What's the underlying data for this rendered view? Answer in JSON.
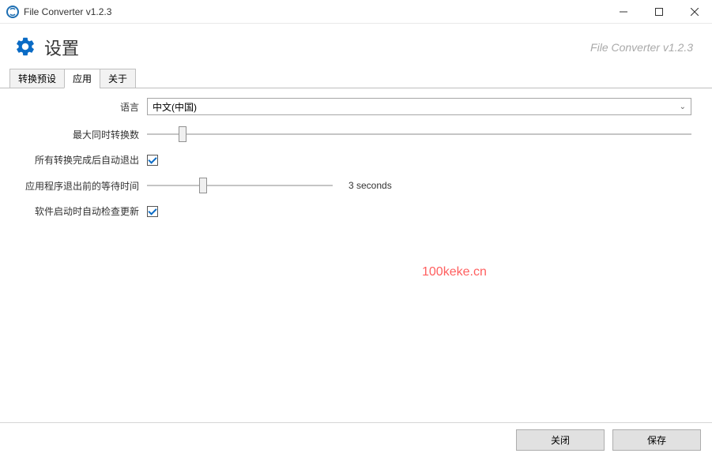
{
  "window": {
    "title": "File Converter v1.2.3"
  },
  "header": {
    "title": "设置",
    "brand": "File Converter v1.2.3"
  },
  "tabs": {
    "t0": "转换预设",
    "t1": "应用",
    "t2": "关于"
  },
  "settings": {
    "language_label": "语言",
    "language_value": "中文(中国)",
    "max_concurrent_label": "最大同时转换数",
    "auto_exit_label": "所有转换完成后自动退出",
    "auto_exit_checked": true,
    "wait_time_label": "应用程序退出前的等待时间",
    "wait_time_value": "3 seconds",
    "check_updates_label": "软件启动时自动检查更新",
    "check_updates_checked": true
  },
  "watermark": "100keke.cn",
  "footer": {
    "close": "关闭",
    "save": "保存"
  }
}
